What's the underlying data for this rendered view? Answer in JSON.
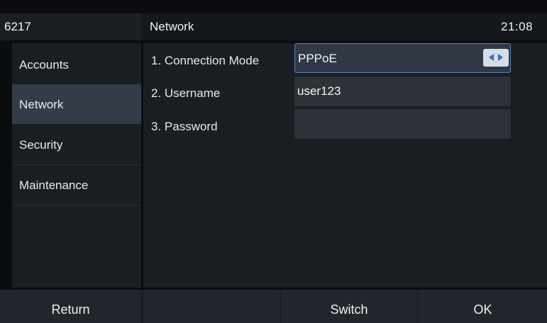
{
  "header": {
    "model": "6217",
    "title": "Network",
    "time": "21:08"
  },
  "sidebar": {
    "items": [
      {
        "label": "Accounts",
        "active": false
      },
      {
        "label": "Network",
        "active": true
      },
      {
        "label": "Security",
        "active": false
      },
      {
        "label": "Maintenance",
        "active": false
      }
    ]
  },
  "form": {
    "fields": [
      {
        "label": "1. Connection Mode",
        "value": "PPPoE",
        "control": "switch",
        "focused": true
      },
      {
        "label": "2. Username",
        "value": "user123",
        "control": "text",
        "focused": false
      },
      {
        "label": "3. Password",
        "value": "",
        "control": "password",
        "focused": false
      }
    ]
  },
  "softkeys": {
    "key1": "Return",
    "key2": "",
    "key3": "Switch",
    "key4": "OK"
  },
  "colors": {
    "accent": "#5b82b8",
    "active_item": "#343c4a",
    "switch_arrows": "#3a6fc4"
  },
  "icons": {
    "switch": "left-right-arrows-icon"
  }
}
